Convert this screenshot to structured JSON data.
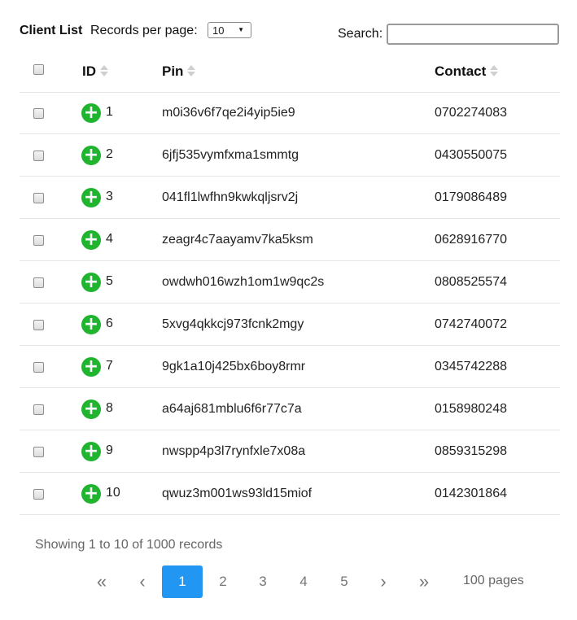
{
  "header": {
    "title": "Client List",
    "records_per_page_label": "Records per page:",
    "records_per_page_value": "10",
    "search_label": "Search:",
    "search_value": ""
  },
  "columns": [
    "ID",
    "Pin",
    "Contact"
  ],
  "rows": [
    {
      "id": "1",
      "pin": "m0i36v6f7qe2i4yip5ie9",
      "contact": "0702274083"
    },
    {
      "id": "2",
      "pin": "6jfj535vymfxma1smmtg",
      "contact": "0430550075"
    },
    {
      "id": "3",
      "pin": "041fl1lwfhn9kwkqljsrv2j",
      "contact": "0179086489"
    },
    {
      "id": "4",
      "pin": "zeagr4c7aayamv7ka5ksm",
      "contact": "0628916770"
    },
    {
      "id": "5",
      "pin": "owdwh016wzh1om1w9qc2s",
      "contact": "0808525574"
    },
    {
      "id": "6",
      "pin": "5xvg4qkkcj973fcnk2mgy",
      "contact": "0742740072"
    },
    {
      "id": "7",
      "pin": "9gk1a10j425bx6boy8rmr",
      "contact": "0345742288"
    },
    {
      "id": "8",
      "pin": "a64aj681mblu6f6r77c7a",
      "contact": "0158980248"
    },
    {
      "id": "9",
      "pin": "nwspp4p3l7rynfxle7x08a",
      "contact": "0859315298"
    },
    {
      "id": "10",
      "pin": "qwuz3m001ws93ld15miof",
      "contact": "0142301864"
    }
  ],
  "footer": {
    "info": "Showing 1 to 10 of 1000 records",
    "pagination": {
      "first": "«",
      "prev": "‹",
      "pages": [
        "1",
        "2",
        "3",
        "4",
        "5"
      ],
      "active_page": "1",
      "next": "›",
      "last": "»",
      "total_pages": "100 pages"
    }
  },
  "colors": {
    "accent": "#2196f3",
    "expand_button": "#21b42f"
  },
  "icons": {
    "sort": "sort-icon",
    "expand": "plus-circle-icon"
  }
}
